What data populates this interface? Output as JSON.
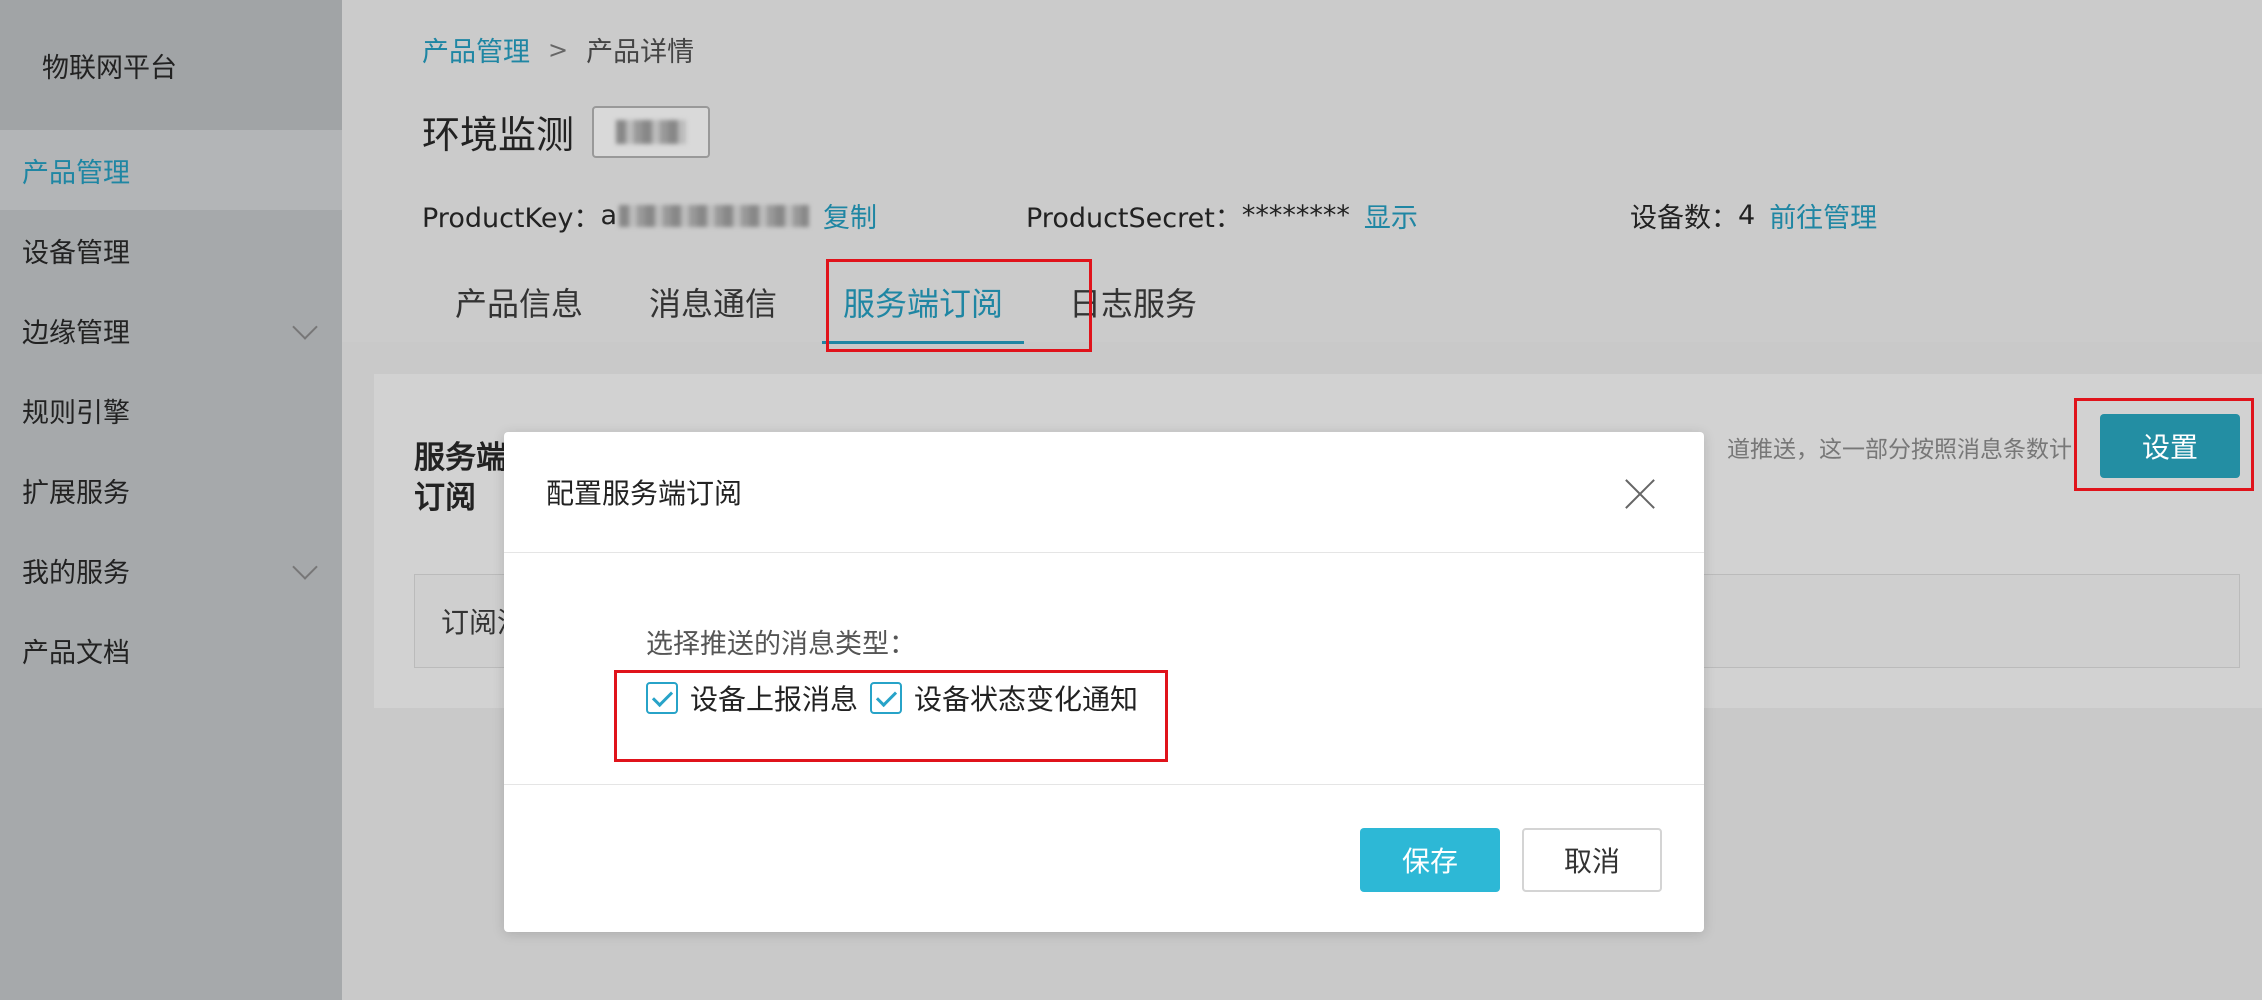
{
  "app": {
    "brand": "物联网平台"
  },
  "sidebar": {
    "items": [
      {
        "label": "产品管理",
        "active": true,
        "chevron": false
      },
      {
        "label": "设备管理",
        "active": false,
        "chevron": false
      },
      {
        "label": "边缘管理",
        "active": false,
        "chevron": true
      },
      {
        "label": "规则引擎",
        "active": false,
        "chevron": false
      },
      {
        "label": "扩展服务",
        "active": false,
        "chevron": false
      },
      {
        "label": "我的服务",
        "active": false,
        "chevron": true
      },
      {
        "label": "产品文档",
        "active": false,
        "chevron": false
      }
    ]
  },
  "breadcrumb": {
    "parent": "产品管理",
    "current": "产品详情"
  },
  "product": {
    "name": "环境监测",
    "product_key_label": "ProductKey：",
    "product_key_prefix": "a",
    "copy_label": "复制",
    "product_secret_label": "ProductSecret：",
    "product_secret_value": "********",
    "show_label": "显示",
    "device_count_label": "设备数：",
    "device_count": "4",
    "manage_label": "前往管理"
  },
  "tabs": [
    "产品信息",
    "消息通信",
    "服务端订阅",
    "日志服务"
  ],
  "active_tab": 2,
  "card": {
    "heading": "服务端订阅",
    "desc": "道推送，这一部分按照消息条数计",
    "box_label": "订阅消",
    "settings_label": "设置"
  },
  "modal": {
    "title": "配置服务端订阅",
    "field_label": "选择推送的消息类型：",
    "options": [
      {
        "label": "设备上报消息",
        "checked": true
      },
      {
        "label": "设备状态变化通知",
        "checked": true
      }
    ],
    "save_label": "保存",
    "cancel_label": "取消"
  },
  "colors": {
    "accent": "#1f86a3",
    "primary_button": "#2db8d6",
    "highlight": "#e0131b"
  }
}
